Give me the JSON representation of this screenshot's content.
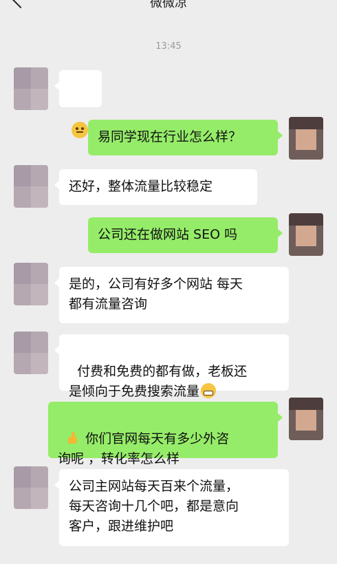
{
  "header": {
    "title": "微微凉",
    "back_icon": "chevron-left-icon",
    "more_label": "···"
  },
  "timestamp": "13:45",
  "messages": [
    {
      "side": "left",
      "type": "emoji",
      "emoji": "slightly-smiling-face-icon"
    },
    {
      "side": "right",
      "text": "易同学现在行业怎么样？"
    },
    {
      "side": "left",
      "text": "还好，整体流量比较稳定"
    },
    {
      "side": "right",
      "text": "公司还在做网站 SEO 吗"
    },
    {
      "side": "left",
      "text": "是的，公司有好多个网站 每天\n都有流量咨询"
    },
    {
      "side": "left",
      "text": "付费和免费的都有做，老板还\n是倾向于免费搜索流量",
      "trailing_emoji": "grinning-face-icon"
    },
    {
      "side": "right",
      "text": "你们官网每天有多少外咨\n询呢 ，转化率怎么样",
      "leading_emoji": "thumbs-up-icon"
    },
    {
      "side": "left",
      "text": "公司主网站每天百来个流量，\n每天咨询十几个吧，都是意向\n客户，跟进维护吧"
    }
  ],
  "colors": {
    "background": "#ededed",
    "incoming_bubble": "#ffffff",
    "outgoing_bubble": "#95ec69"
  }
}
